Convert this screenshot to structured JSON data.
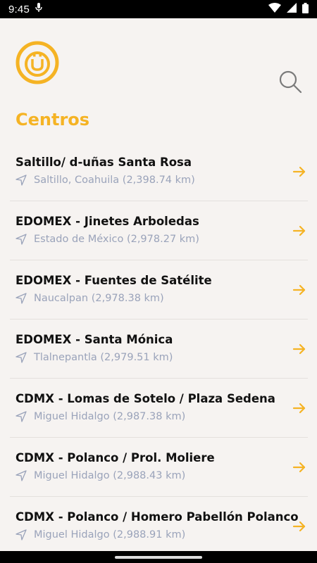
{
  "status_bar": {
    "time": "9:45"
  },
  "header": {
    "logo_icon": "brand-logo-icon",
    "search_icon": "search-icon",
    "accent_color": "#f5b324"
  },
  "page": {
    "title": "Centros"
  },
  "centers": [
    {
      "name": "Saltillo/ d-uñas Santa Rosa",
      "location": "Saltillo, Coahuila (2,398.74 km)"
    },
    {
      "name": "EDOMEX - Jinetes Arboledas",
      "location": "Estado de México (2,978.27 km)"
    },
    {
      "name": "EDOMEX - Fuentes de Satélite",
      "location": "Naucalpan (2,978.38 km)"
    },
    {
      "name": "EDOMEX - Santa Mónica",
      "location": "Tlalnepantla (2,979.51 km)"
    },
    {
      "name": "CDMX - Lomas de Sotelo / Plaza Sedena",
      "location": "Miguel Hidalgo (2,987.38 km)"
    },
    {
      "name": "CDMX - Polanco / Prol. Moliere",
      "location": "Miguel Hidalgo (2,988.43 km)"
    },
    {
      "name": "CDMX - Polanco / Homero Pabellón Polanco",
      "location": "Miguel Hidalgo (2,988.91 km)"
    }
  ]
}
